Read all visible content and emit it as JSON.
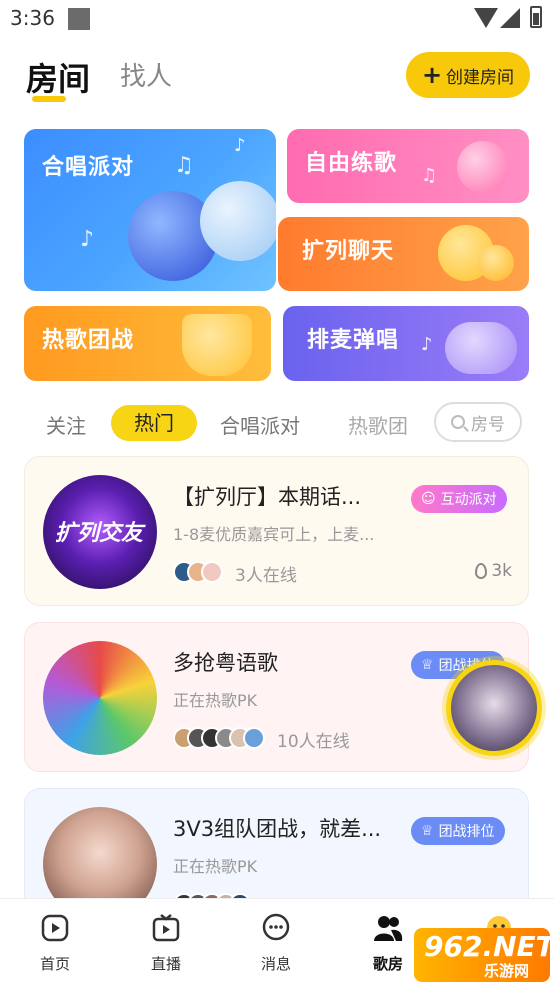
{
  "status_bar": {
    "time": "3:36"
  },
  "header": {
    "tab_rooms": "房间",
    "tab_people": "找人",
    "create_button": "创建房间"
  },
  "categories": [
    {
      "label": "合唱派对"
    },
    {
      "label": "自由练歌"
    },
    {
      "label": "扩列聊天"
    },
    {
      "label": "热歌团战"
    },
    {
      "label": "排麦弹唱"
    }
  ],
  "filters": [
    {
      "label": "关注"
    },
    {
      "label": "热门"
    },
    {
      "label": "合唱派对"
    },
    {
      "label": "热歌团"
    }
  ],
  "room_search": {
    "placeholder": "房号"
  },
  "rooms": [
    {
      "avatar_text": "扩列交友",
      "title": "【扩列厅】本期话...",
      "desc": "1-8麦优质嘉宾可上，上麦...",
      "badge": "互动派对",
      "online": "3人在线",
      "heat": "3k"
    },
    {
      "title": "多抢粤语歌",
      "desc": "正在热歌PK",
      "badge": "团战排位",
      "online": "10人在线"
    },
    {
      "title": "3V3组队团战，就差...",
      "desc": "正在热歌PK",
      "badge": "团战排位"
    }
  ],
  "bottom_nav": [
    {
      "label": "首页"
    },
    {
      "label": "直播"
    },
    {
      "label": "消息"
    },
    {
      "label": "歌房"
    }
  ],
  "watermark": {
    "brand": "962.NET",
    "sub": "乐游网"
  },
  "colors": {
    "accent": "#f7d414",
    "badge_blue": "#6b8cf5"
  }
}
